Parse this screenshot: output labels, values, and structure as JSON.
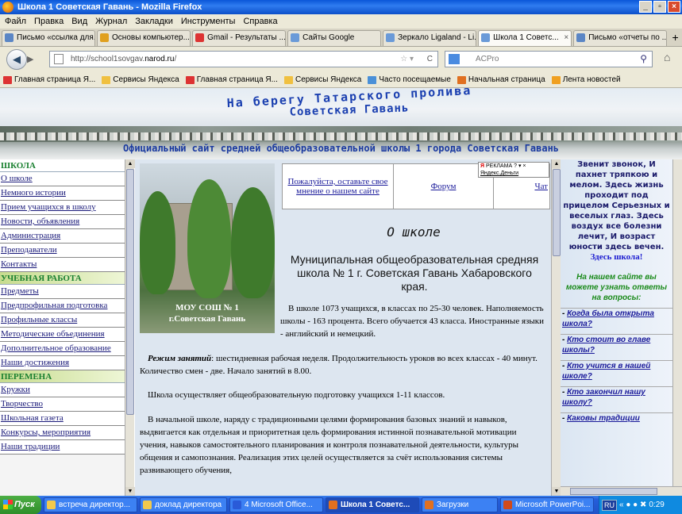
{
  "window": {
    "title": "Школа 1 Советская Гавань - Mozilla Firefox"
  },
  "menu": [
    "Файл",
    "Правка",
    "Вид",
    "Журнал",
    "Закладки",
    "Инструменты",
    "Справка"
  ],
  "tabs": [
    {
      "label": "Письмо «ссылка для...",
      "color": "#5b86c5"
    },
    {
      "label": "Основы компьютер...",
      "color": "#e0a020"
    },
    {
      "label": "Gmail - Результаты ...",
      "color": "#d33"
    },
    {
      "label": "Сайты Google",
      "color": "#6a9ad8"
    },
    {
      "label": "Зеркало Ligaland - Li...",
      "color": "#6a9ad8"
    },
    {
      "label": "Школа 1 Советс...",
      "color": "#6a9ad8",
      "active": true
    },
    {
      "label": "Письмо «отчеты по ...",
      "color": "#5b86c5"
    }
  ],
  "nav": {
    "url_prefix": "http://school1sovgav.",
    "url_domain": "narod.ru",
    "url_suffix": "/",
    "search_placeholder": "ACPro"
  },
  "bookmarks": [
    {
      "label": "Главная страница Я...",
      "color": "#d33"
    },
    {
      "label": "Сервисы Яндекса",
      "color": "#f0c040"
    },
    {
      "label": "Главная страница Я...",
      "color": "#d33"
    },
    {
      "label": "Сервисы Яндекса",
      "color": "#f0c040"
    },
    {
      "label": "Часто посещаемые",
      "color": "#4a90d8"
    },
    {
      "label": "Начальная страница",
      "color": "#e07020"
    },
    {
      "label": "Лента новостей",
      "color": "#f0a020"
    }
  ],
  "banner": {
    "line1": "На берегу Татарского пролива",
    "line2": "Советская Гавань",
    "subtitle": "Официальный сайт средней общеобразовательной школы 1 города Советская Гавань"
  },
  "sidebar": {
    "sections": [
      {
        "head": "ШКОЛА",
        "items": [
          "О школе",
          "Немного истории",
          "Прием учащихся в школу",
          "Новости, объявления",
          "Администрация",
          "Преподаватели",
          "Контакты"
        ]
      },
      {
        "head": "УЧЕБНАЯ РАБОТА",
        "items": [
          "Предметы",
          "Предпрофильная подготовка",
          "Профильные классы",
          "Методические объединения",
          "Дополнительное образование",
          "Наши достижения"
        ]
      },
      {
        "head": "ПЕРЕМЕНА",
        "items": [
          "Кружки",
          "Творчество",
          "Школьная газета",
          "Конкурсы, мероприятия",
          "Наши традиции"
        ]
      }
    ]
  },
  "main": {
    "photo_caption1": "МОУ СОШ № 1",
    "photo_caption2": "г.Советская Гавань",
    "links": [
      "Пожалуйста, оставьте свое мнение о нашем сайте",
      "Форум",
      "Чат"
    ],
    "ad_label": "РЕКЛАМА",
    "ad_sub": "Яндекс.Деньги",
    "title": "О школе",
    "subheading": "Муниципальная общеобразовательная средняя школа № 1 г. Советская Гавань Хабаровского края.",
    "para1": "В школе 1073 учащихся, в классах по 25-30 человек. Наполняемость школы - 163 процента. Всего обучается 43 класса. Иностранные языки - английский и немецкий.",
    "para2_bold": "Режим занятий",
    "para2": ": шестидневная рабочая неделя. Продолжительность уроков во всех классах - 40 минут. Количество смен - две. Начало занятий в 8.00.",
    "para3": "Школа осуществляет общеобразовательную подготовку учащихся 1-11 классов.",
    "para4": "В начальной школе, наряду с традиционными целями формирования базовых знаний и навыков, выдвигается как отдельная и приоритетная цель формирования истинной познавательной мотивации учения, навыков самостоятельного планирования и контроля познавательной деятельности, культуры общения и самопознания. Реализация этих целей осуществляется за счёт использования системы развивающего обучения,"
  },
  "right": {
    "poem": "Звенит звонок, И пахнет тряпкою и мелом. Здесь жизнь проходит под прицелом Серьезных и веселых глаз. Здесь воздух все болезни лечит, И возраст юности здесь вечен.",
    "poem_end": "Здесь школа!",
    "questions_head": "На нашем сайте вы можете узнать ответы на вопросы:",
    "questions": [
      "Когда была открыта школа?",
      "Кто стоит во главе школы?",
      "Кто учится в нашей школе?",
      "Кто закончил нашу школу?",
      "Каковы традиции"
    ]
  },
  "taskbar": {
    "start": "Пуск",
    "items": [
      {
        "label": "встреча директор...",
        "color": "#f2c94c"
      },
      {
        "label": "доклад директора",
        "color": "#f2c94c"
      },
      {
        "label": "4 Microsoft Office...",
        "color": "#2a5bd8"
      },
      {
        "label": "Школа 1 Советс...",
        "color": "#e07020",
        "active": true
      },
      {
        "label": "Загрузки",
        "color": "#e07020"
      },
      {
        "label": "Microsoft PowerPoi...",
        "color": "#d04a1a"
      }
    ],
    "lang": "RU",
    "time": "0:29"
  }
}
